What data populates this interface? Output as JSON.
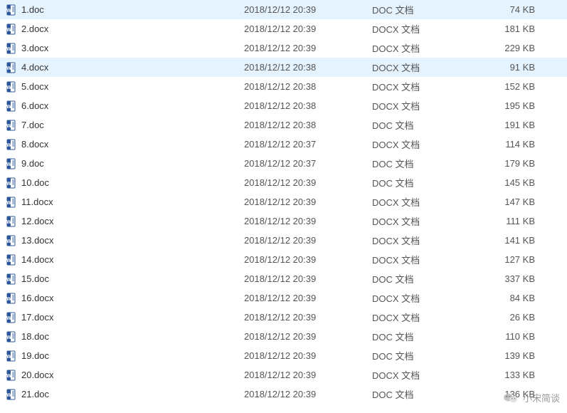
{
  "watermark": "小宋简谈",
  "files": [
    {
      "name": "1.doc",
      "date": "2018/12/12 20:39",
      "type": "DOC 文档",
      "size": "74 KB",
      "icon": "doc"
    },
    {
      "name": "2.docx",
      "date": "2018/12/12 20:39",
      "type": "DOCX 文档",
      "size": "181 KB",
      "icon": "docx"
    },
    {
      "name": "3.docx",
      "date": "2018/12/12 20:39",
      "type": "DOCX 文档",
      "size": "229 KB",
      "icon": "docx"
    },
    {
      "name": "4.docx",
      "date": "2018/12/12 20:38",
      "type": "DOCX 文档",
      "size": "91 KB",
      "icon": "docx",
      "highlighted": true
    },
    {
      "name": "5.docx",
      "date": "2018/12/12 20:38",
      "type": "DOCX 文档",
      "size": "152 KB",
      "icon": "docx"
    },
    {
      "name": "6.docx",
      "date": "2018/12/12 20:38",
      "type": "DOCX 文档",
      "size": "195 KB",
      "icon": "docx"
    },
    {
      "name": "7.doc",
      "date": "2018/12/12 20:38",
      "type": "DOC 文档",
      "size": "191 KB",
      "icon": "doc"
    },
    {
      "name": "8.docx",
      "date": "2018/12/12 20:37",
      "type": "DOCX 文档",
      "size": "114 KB",
      "icon": "docx"
    },
    {
      "name": "9.doc",
      "date": "2018/12/12 20:37",
      "type": "DOC 文档",
      "size": "179 KB",
      "icon": "doc"
    },
    {
      "name": "10.doc",
      "date": "2018/12/12 20:39",
      "type": "DOC 文档",
      "size": "145 KB",
      "icon": "doc"
    },
    {
      "name": "11.docx",
      "date": "2018/12/12 20:39",
      "type": "DOCX 文档",
      "size": "147 KB",
      "icon": "docx"
    },
    {
      "name": "12.docx",
      "date": "2018/12/12 20:39",
      "type": "DOCX 文档",
      "size": "111 KB",
      "icon": "docx"
    },
    {
      "name": "13.docx",
      "date": "2018/12/12 20:39",
      "type": "DOCX 文档",
      "size": "141 KB",
      "icon": "docx"
    },
    {
      "name": "14.docx",
      "date": "2018/12/12 20:39",
      "type": "DOCX 文档",
      "size": "127 KB",
      "icon": "docx"
    },
    {
      "name": "15.doc",
      "date": "2018/12/12 20:39",
      "type": "DOC 文档",
      "size": "337 KB",
      "icon": "doc"
    },
    {
      "name": "16.docx",
      "date": "2018/12/12 20:39",
      "type": "DOCX 文档",
      "size": "84 KB",
      "icon": "docx"
    },
    {
      "name": "17.docx",
      "date": "2018/12/12 20:39",
      "type": "DOCX 文档",
      "size": "26 KB",
      "icon": "docx"
    },
    {
      "name": "18.doc",
      "date": "2018/12/12 20:39",
      "type": "DOC 文档",
      "size": "110 KB",
      "icon": "doc"
    },
    {
      "name": "19.doc",
      "date": "2018/12/12 20:39",
      "type": "DOC 文档",
      "size": "139 KB",
      "icon": "doc"
    },
    {
      "name": "20.docx",
      "date": "2018/12/12 20:39",
      "type": "DOCX 文档",
      "size": "133 KB",
      "icon": "docx"
    },
    {
      "name": "21.doc",
      "date": "2018/12/12 20:39",
      "type": "DOC 文档",
      "size": "136 KB",
      "icon": "doc"
    }
  ]
}
